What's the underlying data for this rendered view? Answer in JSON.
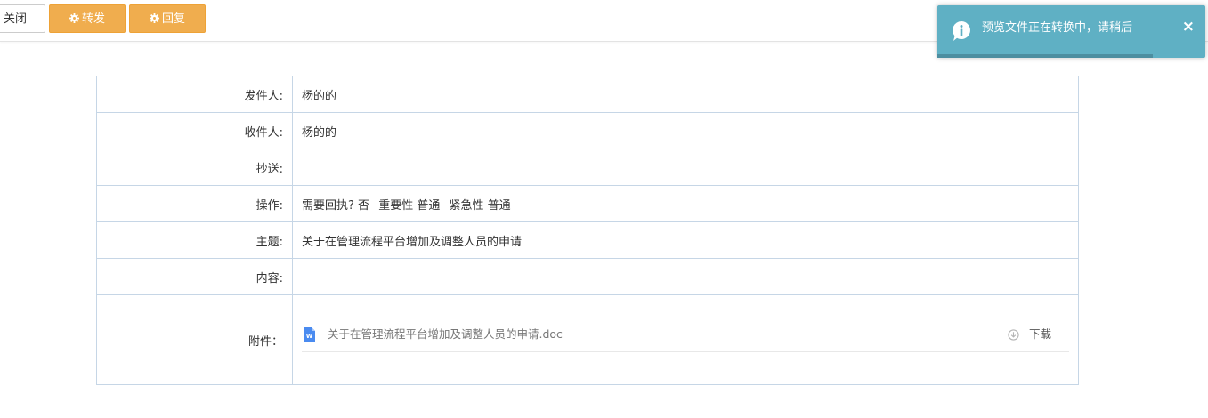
{
  "toolbar": {
    "close_label": "关闭",
    "forward_label": "转发",
    "reply_label": "回复",
    "forward_color": "#f0ad4e",
    "reply_color": "#f0ad4e"
  },
  "fields": {
    "sender": {
      "label": "发件人:",
      "value": "杨的的"
    },
    "recipient": {
      "label": "收件人:",
      "value": "杨的的"
    },
    "cc": {
      "label": "抄送:",
      "value": ""
    },
    "operation": {
      "label": "操作:",
      "receipt": "需要回执? 否",
      "importance": "重要性 普通",
      "urgency": "紧急性 普通"
    },
    "subject": {
      "label": "主题:",
      "value": "关于在管理流程平台增加及调整人员的申请"
    },
    "content": {
      "label": "内容:",
      "value": ""
    },
    "attachments": {
      "label": "附件：",
      "items": [
        {
          "name": "关于在管理流程平台增加及调整人员的申请.doc",
          "download_label": "下载",
          "icon": "word-doc-icon"
        }
      ]
    }
  },
  "toast": {
    "message": "预览文件正在转换中，请稍后",
    "close_symbol": "×",
    "icon": "info-icon",
    "progress": 0.805,
    "background_color": "#5fb0c4"
  }
}
